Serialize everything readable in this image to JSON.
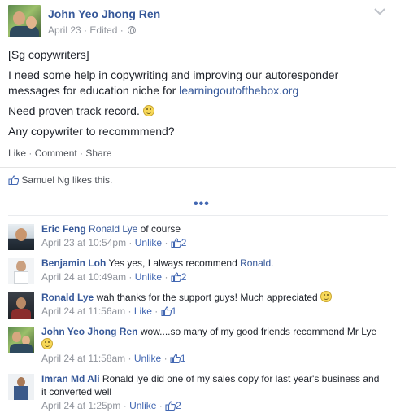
{
  "post": {
    "author": "John Yeo Jhong Ren",
    "date": "April 23",
    "edited": "Edited",
    "dot": "·",
    "lines": {
      "tag": "[Sg copywriters]",
      "para1_a": "I need some help in copywriting and improving our autoresponder messages for education niche for ",
      "para1_link": "learningoutofthebox.org",
      "para2": "Need proven track record.",
      "para3": "Any copywriter to recommmend?"
    },
    "actions": {
      "like": "Like",
      "comment": "Comment",
      "share": "Share"
    },
    "likes_text": "Samuel Ng likes this.",
    "more_dots": "•••"
  },
  "comments": [
    {
      "name": "Eric Feng",
      "mention": "Ronald Lye",
      "text": " of course",
      "time": "April 23 at 10:54pm",
      "action": "Unlike",
      "likes": "2"
    },
    {
      "name": "Benjamin Loh",
      "text": "Yes yes, I always recommend ",
      "mention": "Ronald.",
      "time": "April 24 at 10:49am",
      "action": "Unlike",
      "likes": "2"
    },
    {
      "name": "Ronald Lye",
      "text": "wah thanks for the support guys! Much appreciated",
      "time": "April 24 at 11:56am",
      "action": "Like",
      "likes": "1"
    },
    {
      "name": "John Yeo Jhong Ren",
      "text": "wow....so many of my good friends recommend Mr Lye",
      "time": "April 24 at 11:58am",
      "action": "Unlike",
      "likes": "1"
    },
    {
      "name": "Imran Md Ali",
      "text": "Ronald lye did one of my sales copy for last year's business and it converted well",
      "time": "April 24 at 1:25pm",
      "action": "Unlike",
      "likes": "2"
    }
  ],
  "colors": {
    "link": "#365899",
    "meta": "#90949c",
    "accent": "#4267b2"
  }
}
